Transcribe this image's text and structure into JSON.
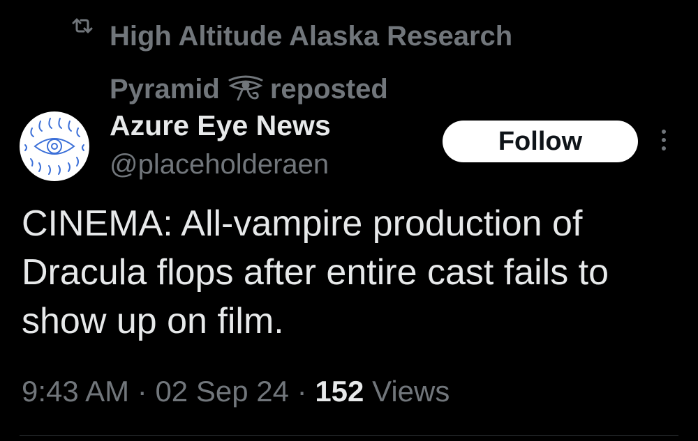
{
  "repost": {
    "text_before_glyph": "High Altitude Alaska Research Pyramid",
    "text_after_glyph": "reposted",
    "icon": "repost-icon",
    "glyph": "eye-of-horus-icon"
  },
  "author": {
    "name": "Azure Eye News",
    "handle": "@placeholderaen",
    "avatar_icon": "eye-logo-icon"
  },
  "follow_button": {
    "label": "Follow"
  },
  "more_button": {
    "icon": "more-vertical-icon"
  },
  "tweet": {
    "text": "CINEMA: All-vampire production of Dracula flops after entire cast fails to show up on film."
  },
  "meta": {
    "time": "9:43 AM",
    "separator": "·",
    "date": "02 Sep 24",
    "views_count": "152",
    "views_label": "Views"
  },
  "colors": {
    "background": "#000000",
    "primary_text": "#e7e9ea",
    "secondary_text": "#71767b",
    "follow_bg": "#ffffff",
    "follow_text": "#0f1419",
    "avatar_lines": "#3b6fd8"
  }
}
